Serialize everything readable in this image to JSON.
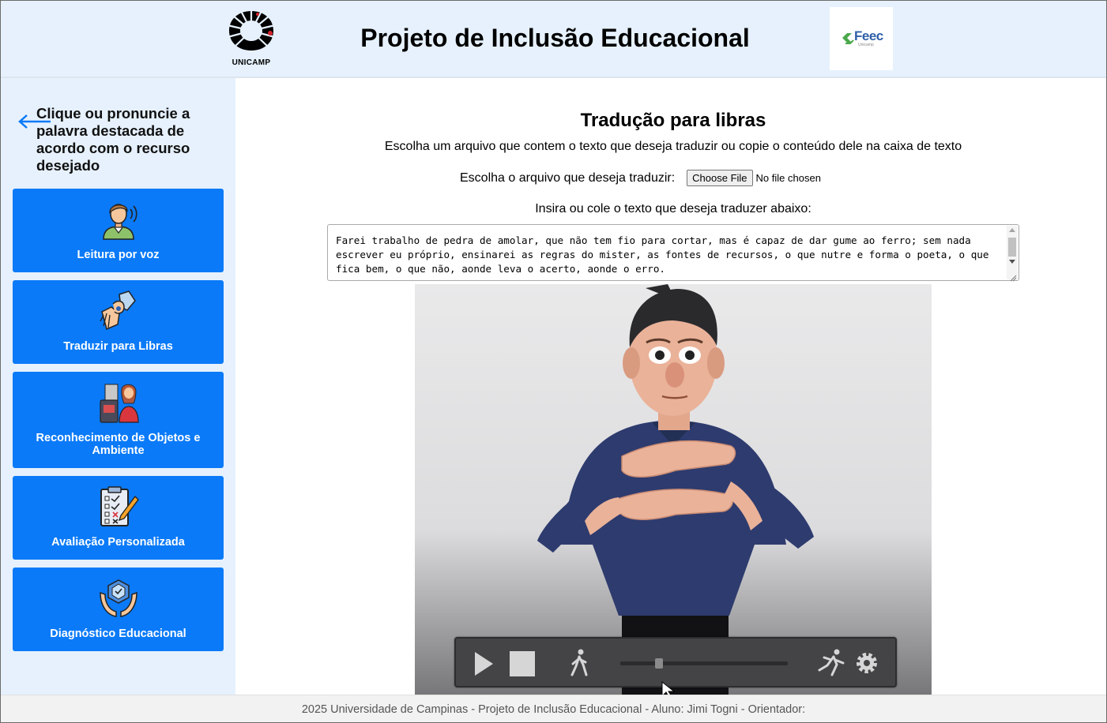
{
  "header": {
    "unicamp_logo_text": "UNICAMP",
    "title": "Projeto de Inclusão Educacional",
    "feec_logo_text": "Feec",
    "feec_logo_sub": "Unicamp"
  },
  "sidebar": {
    "back_icon": "arrow-left-icon",
    "instruction": "Clique ou pronuncie a palavra destacada de acordo com o recurso desejado",
    "items": [
      {
        "label": "Leitura por voz",
        "icon": "voice-reading-icon"
      },
      {
        "label": "Traduzir para Libras",
        "icon": "sign-language-icon"
      },
      {
        "label": "Reconhecimento de Objetos e Ambiente",
        "icon": "object-recognition-icon"
      },
      {
        "label": "Avaliação Personalizada",
        "icon": "checklist-icon"
      },
      {
        "label": "Diagnóstico Educacional",
        "icon": "diagnosis-hands-icon"
      }
    ]
  },
  "main": {
    "title": "Tradução para libras",
    "description": "Escolha um arquivo que contem o texto que deseja traduzir ou copie o conteúdo dele na caixa de texto",
    "file_label": "Escolha o arquivo que deseja traduzir:",
    "file_button": "Choose File",
    "file_status": "No file chosen",
    "text_label": "Insira ou cole o texto que deseja traduzer abaixo:",
    "textarea_value": "Farei trabalho de pedra de amolar, que não tem fio para cortar, mas é capaz de dar gume ao ferro; sem nada escrever eu próprio, ensinarei as regras do mister, as fontes de recursos, o que nutre e forma o poeta, o que fica bem, o que não, aonde leva o acerto, aonde o erro.",
    "player": {
      "slider_position": 0.23,
      "icons": [
        "play-icon",
        "stop-icon",
        "walk-slow-icon",
        "run-fast-icon",
        "settings-gear-icon"
      ]
    }
  },
  "footer": {
    "text": "2025 Universidade de Campinas - Projeto de Inclusão Educacional - Aluno: Jimi Togni - Orientador:"
  },
  "colors": {
    "header_bg": "#e6f1fd",
    "sidebar_bg": "#e6f1fd",
    "button_bg": "#0a7af8",
    "footer_bg": "#f2f2f2"
  }
}
